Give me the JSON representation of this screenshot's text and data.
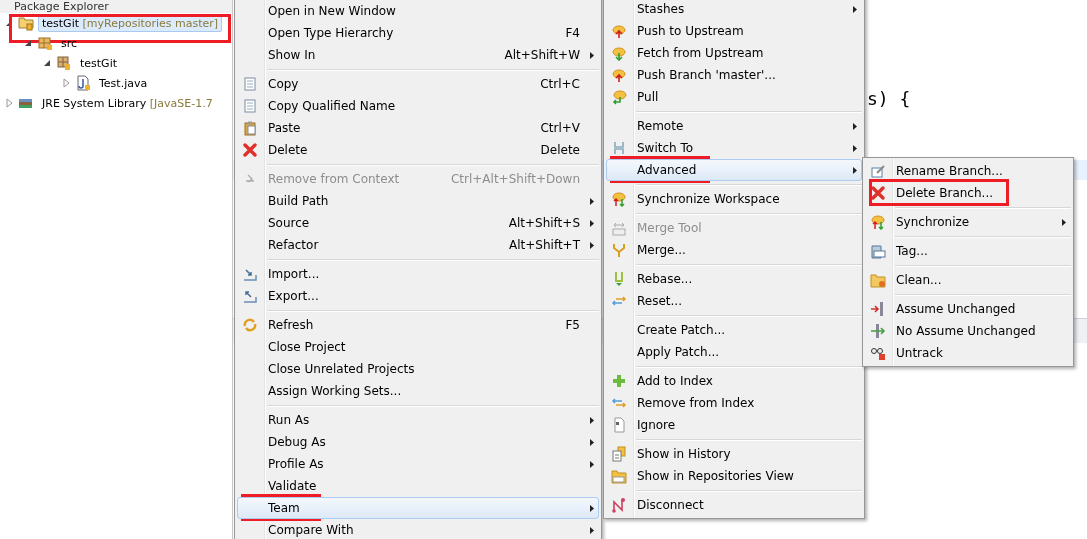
{
  "package_explorer": {
    "title": "Package Explorer",
    "tree": [
      {
        "kind": "project",
        "label": "testGit",
        "decoration": "[myRepositories master]",
        "selected": true,
        "marked": true,
        "expanded": true,
        "children": [
          {
            "kind": "folder",
            "label": "src",
            "selected": false,
            "marked": false,
            "expanded": true,
            "children": [
              {
                "kind": "package",
                "label": "testGit",
                "selected": false,
                "marked": false,
                "expanded": true,
                "children": [
                  {
                    "kind": "file",
                    "label": "Test.java",
                    "selected": false,
                    "marked": false,
                    "expanded": false
                  }
                ]
              }
            ]
          }
        ]
      },
      {
        "kind": "library",
        "label": "JRE System Library",
        "decoration": "[JavaSE-1.7",
        "selected": false,
        "marked": false,
        "expanded": false
      }
    ]
  },
  "editor": {
    "visible_code": "s) {"
  },
  "menus": [
    {
      "items": [
        {
          "kind": "item",
          "label": "Open in New Window",
          "selected": false,
          "disabled": false,
          "marked": false,
          "submenu": false
        },
        {
          "kind": "item",
          "label": "Open Type Hierarchy",
          "shortcut": "F4",
          "selected": false,
          "disabled": false,
          "marked": false,
          "submenu": false
        },
        {
          "kind": "item",
          "label": "Show In",
          "shortcut": "Alt+Shift+W",
          "selected": false,
          "disabled": false,
          "marked": false,
          "submenu": true
        },
        {
          "kind": "separator"
        },
        {
          "kind": "item",
          "label": "Copy",
          "shortcut": "Ctrl+C",
          "selected": false,
          "disabled": false,
          "marked": false,
          "submenu": false
        },
        {
          "kind": "item",
          "label": "Copy Qualified Name",
          "selected": false,
          "disabled": false,
          "marked": false,
          "submenu": false
        },
        {
          "kind": "item",
          "label": "Paste",
          "shortcut": "Ctrl+V",
          "selected": false,
          "disabled": false,
          "marked": false,
          "submenu": false
        },
        {
          "kind": "item",
          "label": "Delete",
          "shortcut": "Delete",
          "selected": false,
          "disabled": false,
          "marked": false,
          "submenu": false
        },
        {
          "kind": "separator"
        },
        {
          "kind": "item",
          "label": "Remove from Context",
          "shortcut": "Ctrl+Alt+Shift+Down",
          "selected": false,
          "disabled": true,
          "marked": false,
          "submenu": false
        },
        {
          "kind": "item",
          "label": "Build Path",
          "selected": false,
          "disabled": false,
          "marked": false,
          "submenu": true
        },
        {
          "kind": "item",
          "label": "Source",
          "shortcut": "Alt+Shift+S",
          "selected": false,
          "disabled": false,
          "marked": false,
          "submenu": true
        },
        {
          "kind": "item",
          "label": "Refactor",
          "shortcut": "Alt+Shift+T",
          "selected": false,
          "disabled": false,
          "marked": false,
          "submenu": true
        },
        {
          "kind": "separator"
        },
        {
          "kind": "item",
          "label": "Import...",
          "selected": false,
          "disabled": false,
          "marked": false,
          "submenu": false
        },
        {
          "kind": "item",
          "label": "Export...",
          "selected": false,
          "disabled": false,
          "marked": false,
          "submenu": false
        },
        {
          "kind": "separator"
        },
        {
          "kind": "item",
          "label": "Refresh",
          "shortcut": "F5",
          "selected": false,
          "disabled": false,
          "marked": false,
          "submenu": false
        },
        {
          "kind": "item",
          "label": "Close Project",
          "selected": false,
          "disabled": false,
          "marked": false,
          "submenu": false
        },
        {
          "kind": "item",
          "label": "Close Unrelated Projects",
          "selected": false,
          "disabled": false,
          "marked": false,
          "submenu": false
        },
        {
          "kind": "item",
          "label": "Assign Working Sets...",
          "selected": false,
          "disabled": false,
          "marked": false,
          "submenu": false
        },
        {
          "kind": "separator"
        },
        {
          "kind": "item",
          "label": "Run As",
          "selected": false,
          "disabled": false,
          "marked": false,
          "submenu": true
        },
        {
          "kind": "item",
          "label": "Debug As",
          "selected": false,
          "disabled": false,
          "marked": false,
          "submenu": true
        },
        {
          "kind": "item",
          "label": "Profile As",
          "selected": false,
          "disabled": false,
          "marked": false,
          "submenu": true
        },
        {
          "kind": "item",
          "label": "Validate",
          "selected": false,
          "disabled": false,
          "marked": false,
          "submenu": false
        },
        {
          "kind": "item",
          "label": "Team",
          "selected": true,
          "disabled": false,
          "marked": true,
          "submenu": true
        },
        {
          "kind": "item",
          "label": "Compare With",
          "selected": false,
          "disabled": false,
          "marked": false,
          "submenu": true
        }
      ]
    },
    {
      "items": [
        {
          "kind": "item",
          "label": "Stashes",
          "selected": false,
          "disabled": false,
          "marked": false,
          "submenu": true
        },
        {
          "kind": "item",
          "label": "Push to Upstream",
          "selected": false,
          "disabled": false,
          "marked": false,
          "submenu": false
        },
        {
          "kind": "item",
          "label": "Fetch from Upstream",
          "selected": false,
          "disabled": false,
          "marked": false,
          "submenu": false
        },
        {
          "kind": "item",
          "label": "Push Branch 'master'...",
          "selected": false,
          "disabled": false,
          "marked": false,
          "submenu": false
        },
        {
          "kind": "item",
          "label": "Pull",
          "selected": false,
          "disabled": false,
          "marked": false,
          "submenu": false
        },
        {
          "kind": "separator"
        },
        {
          "kind": "item",
          "label": "Remote",
          "selected": false,
          "disabled": false,
          "marked": false,
          "submenu": true
        },
        {
          "kind": "item",
          "label": "Switch To",
          "selected": false,
          "disabled": false,
          "marked": false,
          "submenu": true
        },
        {
          "kind": "item",
          "label": "Advanced",
          "selected": true,
          "disabled": false,
          "marked": true,
          "submenu": true
        },
        {
          "kind": "separator"
        },
        {
          "kind": "item",
          "label": "Synchronize Workspace",
          "selected": false,
          "disabled": false,
          "marked": false,
          "submenu": false
        },
        {
          "kind": "separator"
        },
        {
          "kind": "item",
          "label": "Merge Tool",
          "selected": false,
          "disabled": true,
          "marked": false,
          "submenu": false
        },
        {
          "kind": "item",
          "label": "Merge...",
          "selected": false,
          "disabled": false,
          "marked": false,
          "submenu": false
        },
        {
          "kind": "separator"
        },
        {
          "kind": "item",
          "label": "Rebase...",
          "selected": false,
          "disabled": false,
          "marked": false,
          "submenu": false
        },
        {
          "kind": "item",
          "label": "Reset...",
          "selected": false,
          "disabled": false,
          "marked": false,
          "submenu": false
        },
        {
          "kind": "separator"
        },
        {
          "kind": "item",
          "label": "Create Patch...",
          "selected": false,
          "disabled": false,
          "marked": false,
          "submenu": false
        },
        {
          "kind": "item",
          "label": "Apply Patch...",
          "selected": false,
          "disabled": false,
          "marked": false,
          "submenu": false
        },
        {
          "kind": "separator"
        },
        {
          "kind": "item",
          "label": "Add to Index",
          "selected": false,
          "disabled": false,
          "marked": false,
          "submenu": false
        },
        {
          "kind": "item",
          "label": "Remove from Index",
          "selected": false,
          "disabled": false,
          "marked": false,
          "submenu": false
        },
        {
          "kind": "item",
          "label": "Ignore",
          "selected": false,
          "disabled": false,
          "marked": false,
          "submenu": false
        },
        {
          "kind": "separator"
        },
        {
          "kind": "item",
          "label": "Show in History",
          "selected": false,
          "disabled": false,
          "marked": false,
          "submenu": false
        },
        {
          "kind": "item",
          "label": "Show in Repositories View",
          "selected": false,
          "disabled": false,
          "marked": false,
          "submenu": false
        },
        {
          "kind": "separator"
        },
        {
          "kind": "item",
          "label": "Disconnect",
          "selected": false,
          "disabled": false,
          "marked": false,
          "submenu": false
        }
      ]
    },
    {
      "items": [
        {
          "kind": "item",
          "label": "Rename Branch...",
          "selected": false,
          "disabled": false,
          "marked": false,
          "submenu": false
        },
        {
          "kind": "item",
          "label": "Delete Branch...",
          "selected": false,
          "disabled": false,
          "marked": true,
          "submenu": false
        },
        {
          "kind": "separator"
        },
        {
          "kind": "item",
          "label": "Synchronize",
          "selected": false,
          "disabled": false,
          "marked": false,
          "submenu": true
        },
        {
          "kind": "separator"
        },
        {
          "kind": "item",
          "label": "Tag...",
          "selected": false,
          "disabled": false,
          "marked": false,
          "submenu": false
        },
        {
          "kind": "separator"
        },
        {
          "kind": "item",
          "label": "Clean...",
          "selected": false,
          "disabled": false,
          "marked": false,
          "submenu": false
        },
        {
          "kind": "separator"
        },
        {
          "kind": "item",
          "label": "Assume Unchanged",
          "selected": false,
          "disabled": false,
          "marked": false,
          "submenu": false
        },
        {
          "kind": "item",
          "label": "No Assume Unchanged",
          "selected": false,
          "disabled": false,
          "marked": false,
          "submenu": false
        },
        {
          "kind": "item",
          "label": "Untrack",
          "selected": false,
          "disabled": false,
          "marked": false,
          "submenu": false
        }
      ]
    }
  ]
}
